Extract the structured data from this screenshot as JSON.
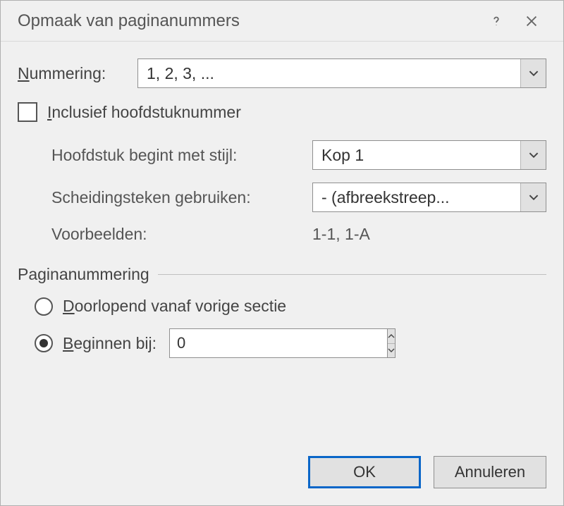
{
  "titlebar": {
    "title": "Opmaak van paginanummers"
  },
  "numbering": {
    "label": "Nummering:",
    "value": "1, 2, 3, ..."
  },
  "include_chapter": {
    "label": "nclusief hoofdstuknummer",
    "first_letter": "I",
    "checked": false
  },
  "chapter_style": {
    "label": "Hoofdstuk begint met stijl:",
    "value": "Kop 1"
  },
  "separator": {
    "label": "Scheidingsteken gebruiken:",
    "value": "-    (afbreekstreep..."
  },
  "examples": {
    "label": "Voorbeelden:",
    "value": "1-1, 1-A"
  },
  "page_numbering": {
    "group": "Paginanummering",
    "continue": {
      "first_letter": "D",
      "rest": "oorlopend vanaf vorige sectie"
    },
    "start_at": {
      "first_letter": "B",
      "rest": "eginnen bij:",
      "value": "0",
      "selected": true
    }
  },
  "buttons": {
    "ok": "OK",
    "cancel": "Annuleren"
  }
}
